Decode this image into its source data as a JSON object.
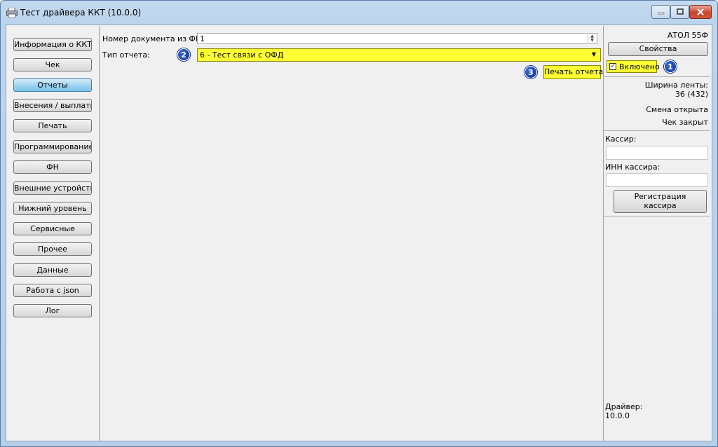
{
  "window": {
    "title": "Тест драйвера ККТ (10.0.0)"
  },
  "nav": {
    "items": [
      {
        "label": "Информация о ККТ"
      },
      {
        "label": "Чек"
      },
      {
        "label": "Отчеты"
      },
      {
        "label": "Внесения / выплаты"
      },
      {
        "label": "Печать"
      },
      {
        "label": "Программирование"
      },
      {
        "label": "ФН"
      },
      {
        "label": "Внешние устройства"
      },
      {
        "label": "Нижний уровень"
      },
      {
        "label": "Сервисные"
      },
      {
        "label": "Прочее"
      },
      {
        "label": "Данные"
      },
      {
        "label": "Работа с json"
      },
      {
        "label": "Лог"
      }
    ],
    "active": "Отчеты"
  },
  "reports": {
    "doc_number_label": "Номер документа из ФН:",
    "doc_number_value": "1",
    "report_type_label": "Тип отчета:",
    "report_type_value": "6 - Тест связи с ОФД",
    "print_button": "Печать отчета",
    "highlight_color": "#ffff33"
  },
  "markers": {
    "m1": "1",
    "m2": "2",
    "m3": "3",
    "color": "#0a2a8a"
  },
  "device": {
    "model": "АТОЛ 55Ф",
    "properties_button": "Свойства",
    "enabled_label": "Включено",
    "enabled": true,
    "tape_width_label": "Ширина ленты:",
    "tape_width_value": "36 (432)",
    "shift_status": "Смена открыта",
    "receipt_status": "Чек закрыт",
    "cashier_label": "Кассир:",
    "cashier_value": "",
    "cashier_inn_label": "ИНН кассира:",
    "cashier_inn_value": "",
    "register_cashier_line1": "Регистрация",
    "register_cashier_line2": "кассира",
    "driver_label": "Драйвер:",
    "driver_version": "10.0.0"
  }
}
